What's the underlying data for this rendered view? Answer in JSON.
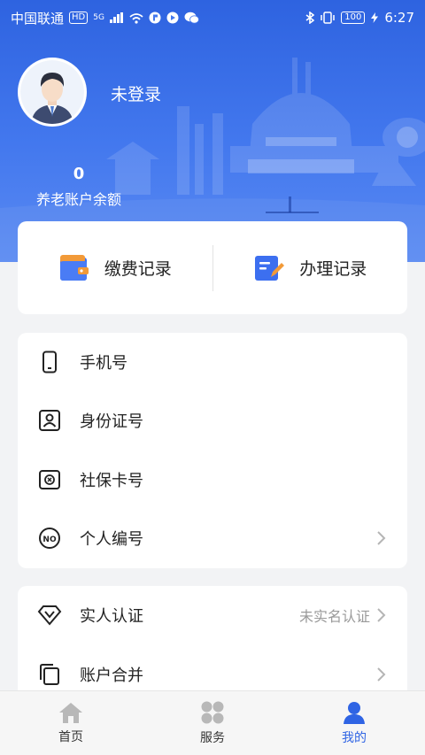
{
  "status_bar": {
    "carrier": "中国联通",
    "hd": "HD",
    "net": "5G",
    "battery": "100",
    "time": "6:27"
  },
  "profile": {
    "username": "未登录",
    "balance_value": "0",
    "balance_label": "养老账户余额"
  },
  "records": {
    "payment_label": "缴费记录",
    "handling_label": "办理记录"
  },
  "info_list": [
    {
      "label": "手机号",
      "icon": "phone-icon"
    },
    {
      "label": "身份证号",
      "icon": "id-card-icon"
    },
    {
      "label": "社保卡号",
      "icon": "social-card-icon"
    },
    {
      "label": "个人编号",
      "icon": "no-icon"
    }
  ],
  "auth_list": [
    {
      "label": "实人认证",
      "value": "未实名认证",
      "icon": "verify-icon"
    },
    {
      "label": "账户合并",
      "value": "",
      "icon": "merge-icon"
    }
  ],
  "bottom_nav": [
    {
      "label": "首页",
      "icon": "home-icon"
    },
    {
      "label": "服务",
      "icon": "grid-icon"
    },
    {
      "label": "我的",
      "icon": "user-icon"
    }
  ],
  "colors": {
    "primary": "#2f64e4",
    "header_top": "#2e63e0",
    "wallet_orange": "#f29a38",
    "edit_blue": "#3c6ff0"
  }
}
